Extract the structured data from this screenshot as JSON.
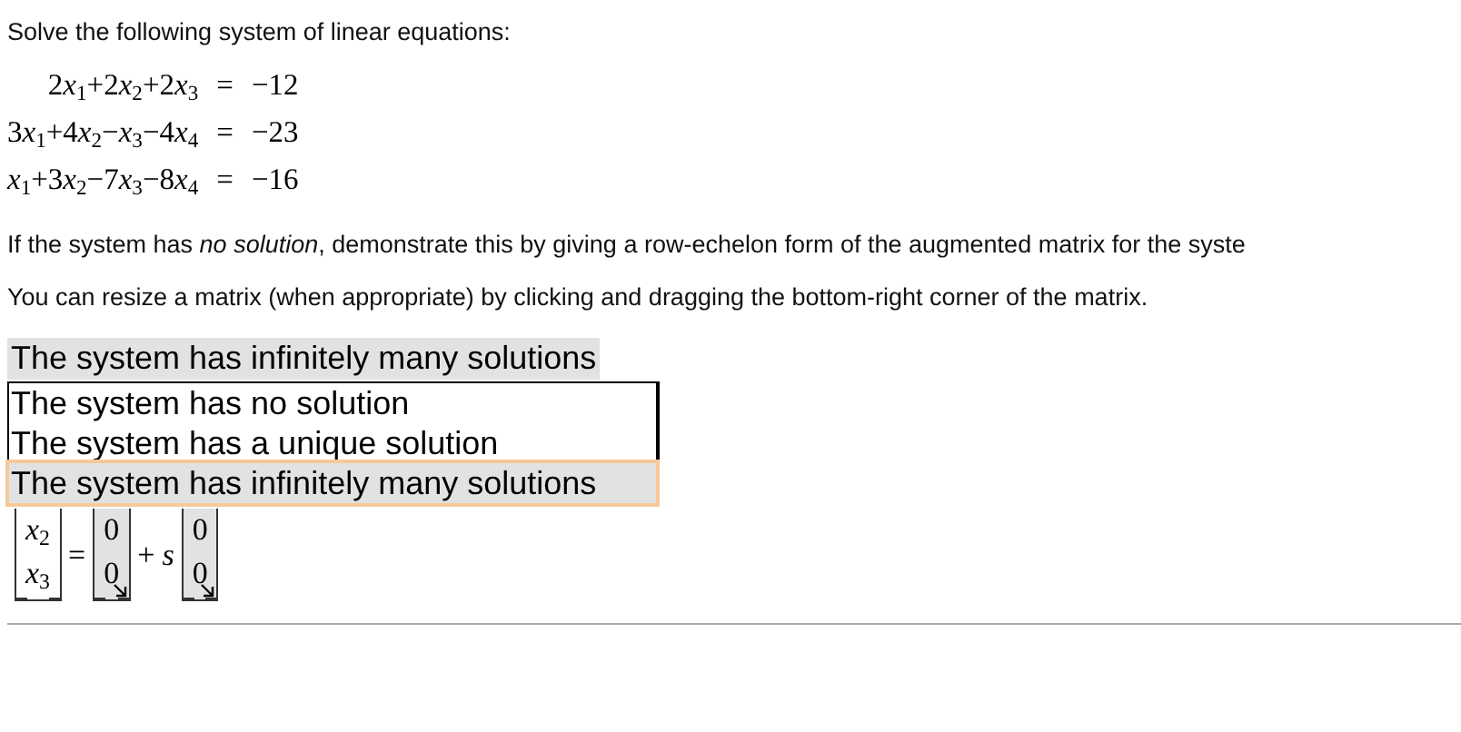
{
  "prompt": "Solve the following system of linear equations:",
  "equations": [
    {
      "terms": [
        {
          "coef": "2",
          "variable": "x",
          "index": "1"
        },
        {
          "sign": "+",
          "coef": "2",
          "variable": "x",
          "index": "2"
        },
        {
          "sign": "+",
          "coef": "2",
          "variable": "x",
          "index": "3"
        }
      ],
      "relation": "=",
      "rhs": "−12"
    },
    {
      "terms": [
        {
          "coef": "3",
          "variable": "x",
          "index": "1"
        },
        {
          "sign": "+",
          "coef": "4",
          "variable": "x",
          "index": "2"
        },
        {
          "sign": "−",
          "variable": "x",
          "index": "3"
        },
        {
          "sign": "−",
          "coef": "4",
          "variable": "x",
          "index": "4"
        }
      ],
      "relation": "=",
      "rhs": "−23"
    },
    {
      "terms": [
        {
          "variable": "x",
          "index": "1"
        },
        {
          "sign": "+",
          "coef": "3",
          "variable": "x",
          "index": "2"
        },
        {
          "sign": "−",
          "coef": "7",
          "variable": "x",
          "index": "3"
        },
        {
          "sign": "−",
          "coef": "8",
          "variable": "x",
          "index": "4"
        }
      ],
      "relation": "=",
      "rhs": "−16"
    }
  ],
  "note": "If the system has *no solution*, demonstrate this by giving a row-echelon form of the augmented matrix for the syste",
  "hint": "You can resize a matrix (when appropriate) by clicking and dragging the bottom-right corner of the matrix.",
  "answer_select": {
    "value": "The system has infinitely many solutions",
    "expanded": true,
    "options": [
      {
        "label": "The system has no solution",
        "selected": false
      },
      {
        "label": "The system has a unique solution",
        "selected": false
      },
      {
        "label": "The system has infinitely many solutions",
        "selected": true
      }
    ]
  },
  "solution": {
    "variables": [
      "*x*$_{2}$",
      "*x*$_{3}$"
    ],
    "equals": "=",
    "particular": [
      "0",
      "0"
    ],
    "plus": "+",
    "parameter": "s",
    "direction": [
      "0",
      "0"
    ]
  }
}
